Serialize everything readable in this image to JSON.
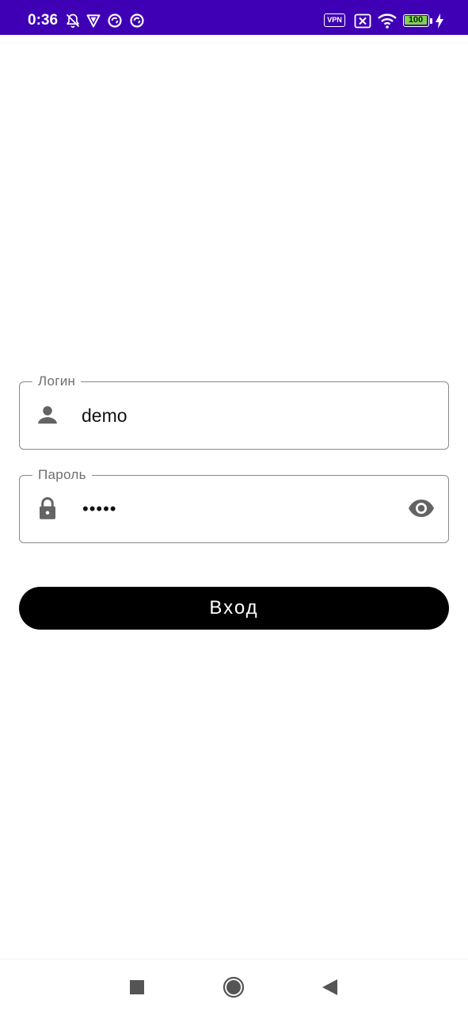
{
  "status_bar": {
    "time": "0:36",
    "vpn_label": "VPN",
    "battery_level": "100",
    "background_color": "#3f00b5",
    "icons": [
      "bell-off-icon",
      "shield-icon",
      "sync-icon",
      "sync-icon",
      "vpn-icon",
      "no-sim-icon",
      "wifi-icon",
      "battery-icon",
      "charging-icon"
    ]
  },
  "login_form": {
    "login_field": {
      "label": "Логин",
      "value": "demo",
      "icon": "person-icon"
    },
    "password_field": {
      "label": "Пароль",
      "masked_value": "•••••",
      "icon": "lock-icon",
      "toggle_icon": "eye-icon"
    },
    "submit_label": "Вход"
  },
  "nav_bar": {
    "buttons": [
      "recents-button",
      "home-button",
      "back-button"
    ]
  }
}
